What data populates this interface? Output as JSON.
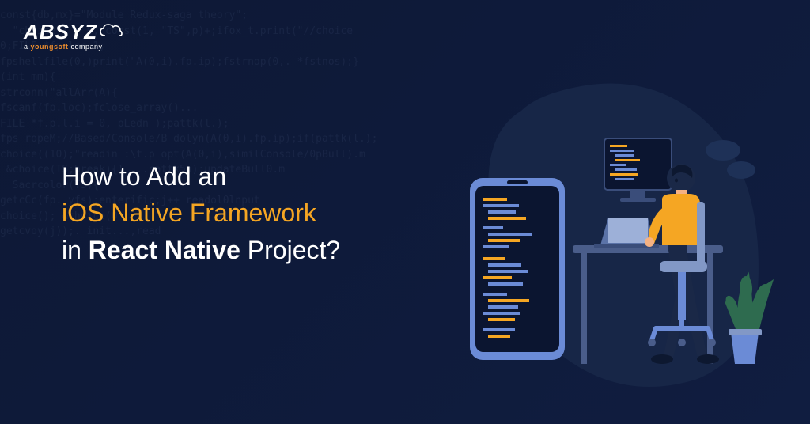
{
  "logo": {
    "text": "ABSYZ",
    "tagline_prefix": "a ",
    "tagline_accent": "youngsoft",
    "tagline_suffix": " company"
  },
  "headline": {
    "line1": "How to Add an",
    "line2": "iOS Native Framework",
    "line3_prefix": "in ",
    "line3_bold": "React Native",
    "line3_suffix": " Project?"
  },
  "code_background": "const{db,mx}=\"Module Redux-saga theory\";\n  \"choice\") = 0, const(1, \"TS\",p)+;ifox_t.print(\"//choice\n0;FILE *fp.loc 1;\nfpshellfile(0,)print(\"A(0,i).fp.ip);fstrnop(0,. *fstnos);}\n(int mm){\nstrconn(\"allArr(A){\nfscanf(fp.loc);fclose_array()...\nFILE *f.p.l.i = 0, pLedn );pattk(l.);\nfps ropeM;//Based/Console/B dolyn(A(0,i).fp.ip);if(pattk(l.);\nchoice((10);\"readin :\\t.p opt(A(0,i),similConsole/0pBull).m\n &choice(TS;break){} ...pattk5n);updateBull0.m\n  Sacrcolor(TS){\ngetcCc(fp. yfs);enterific;j++ readol0lnput\nchoice(); &choice(0\ngetcvoy(j));. init...,read"
}
